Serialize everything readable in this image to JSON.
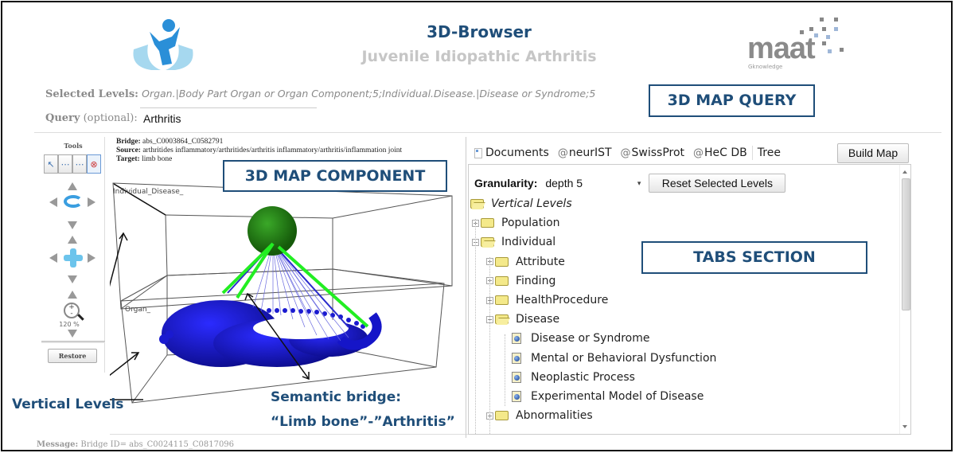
{
  "header": {
    "title": "3D-Browser",
    "subtitle": "Juvenile Idiopathic Arthritis",
    "logo_left": "child-hands-logo",
    "logo_right": {
      "name": "maat",
      "tagline": "Gknowledge"
    }
  },
  "query": {
    "selected_levels_label": "Selected Levels:",
    "selected_levels_value": "Organ.|Body Part Organ or Organ Component;5;Individual.Disease.|Disease or Syndrome;5",
    "query_label": "Query",
    "query_optional": "(optional):",
    "query_value": "Arthritis"
  },
  "callouts": {
    "query": "3D MAP QUERY",
    "map": "3D MAP COMPONENT",
    "tabs": "TABS SECTION"
  },
  "tools": {
    "title": "Tools",
    "buttons": [
      {
        "name": "select-tool",
        "glyph": "↖"
      },
      {
        "name": "rotate-tool",
        "glyph": "⋯"
      },
      {
        "name": "pan-tool",
        "glyph": "⋯"
      },
      {
        "name": "target-tool",
        "glyph": "⊗"
      }
    ],
    "zoom_level": "120 %",
    "restore_label": "Restore"
  },
  "bridge": {
    "bridge_label": "Bridge:",
    "bridge_value": "abs_C0003864_C0582791",
    "source_label": "Source:",
    "source_value": "arthritides inflammatory/arthritides/arthritis inflammatory/arthritis/inflammation joint",
    "target_label": "Target:",
    "target_value": "limb bone"
  },
  "map": {
    "upper_level_label": "Individual_Disease_",
    "lower_level_label": "Organ_",
    "colors": {
      "source_sphere": "#2e8b1a",
      "target_nodes": "#1a1ad0",
      "bridge_highlight": "#22ee22",
      "bridge_line": "#2a2acc"
    }
  },
  "annotations": {
    "vertical_levels": "Vertical Levels",
    "semantic_bridge_line1": "Semantic bridge:",
    "semantic_bridge_line2": "“Limb bone”-”Arthritis”"
  },
  "message": {
    "label": "Message:",
    "value": "Bridge ID= abs_C0024115_C0817096"
  },
  "tabs": {
    "items": [
      {
        "label": "Documents",
        "icon": "document-icon"
      },
      {
        "label": "neurIST",
        "icon": "at-icon"
      },
      {
        "label": "SwissProt",
        "icon": "at-icon"
      },
      {
        "label": "HeC DB",
        "icon": "at-icon"
      },
      {
        "label": "Tree",
        "icon": "tree-icon"
      }
    ],
    "build_map_label": "Build Map"
  },
  "tree_panel": {
    "granularity_label": "Granularity:",
    "granularity_value": "depth 5",
    "reset_label": "Reset Selected Levels",
    "nodes": [
      {
        "label": "Vertical Levels",
        "depth": 0,
        "type": "folder-open",
        "expander": ""
      },
      {
        "label": "Population",
        "depth": 1,
        "type": "folder",
        "expander": "+"
      },
      {
        "label": "Individual",
        "depth": 1,
        "type": "folder-open",
        "expander": "−"
      },
      {
        "label": "Attribute",
        "depth": 2,
        "type": "folder",
        "expander": "+"
      },
      {
        "label": "Finding",
        "depth": 2,
        "type": "folder",
        "expander": "+"
      },
      {
        "label": "HealthProcedure",
        "depth": 2,
        "type": "folder",
        "expander": "+"
      },
      {
        "label": "Disease",
        "depth": 2,
        "type": "folder-open",
        "expander": "−"
      },
      {
        "label": "Disease or Syndrome",
        "depth": 3,
        "type": "leaf",
        "expander": ""
      },
      {
        "label": "Mental or Behavioral Dysfunction",
        "depth": 3,
        "type": "leaf",
        "expander": ""
      },
      {
        "label": "Neoplastic Process",
        "depth": 3,
        "type": "leaf",
        "expander": ""
      },
      {
        "label": "Experimental Model of Disease",
        "depth": 3,
        "type": "leaf",
        "expander": ""
      },
      {
        "label": "Abnormalities",
        "depth": 2,
        "type": "folder",
        "expander": "+"
      }
    ]
  }
}
